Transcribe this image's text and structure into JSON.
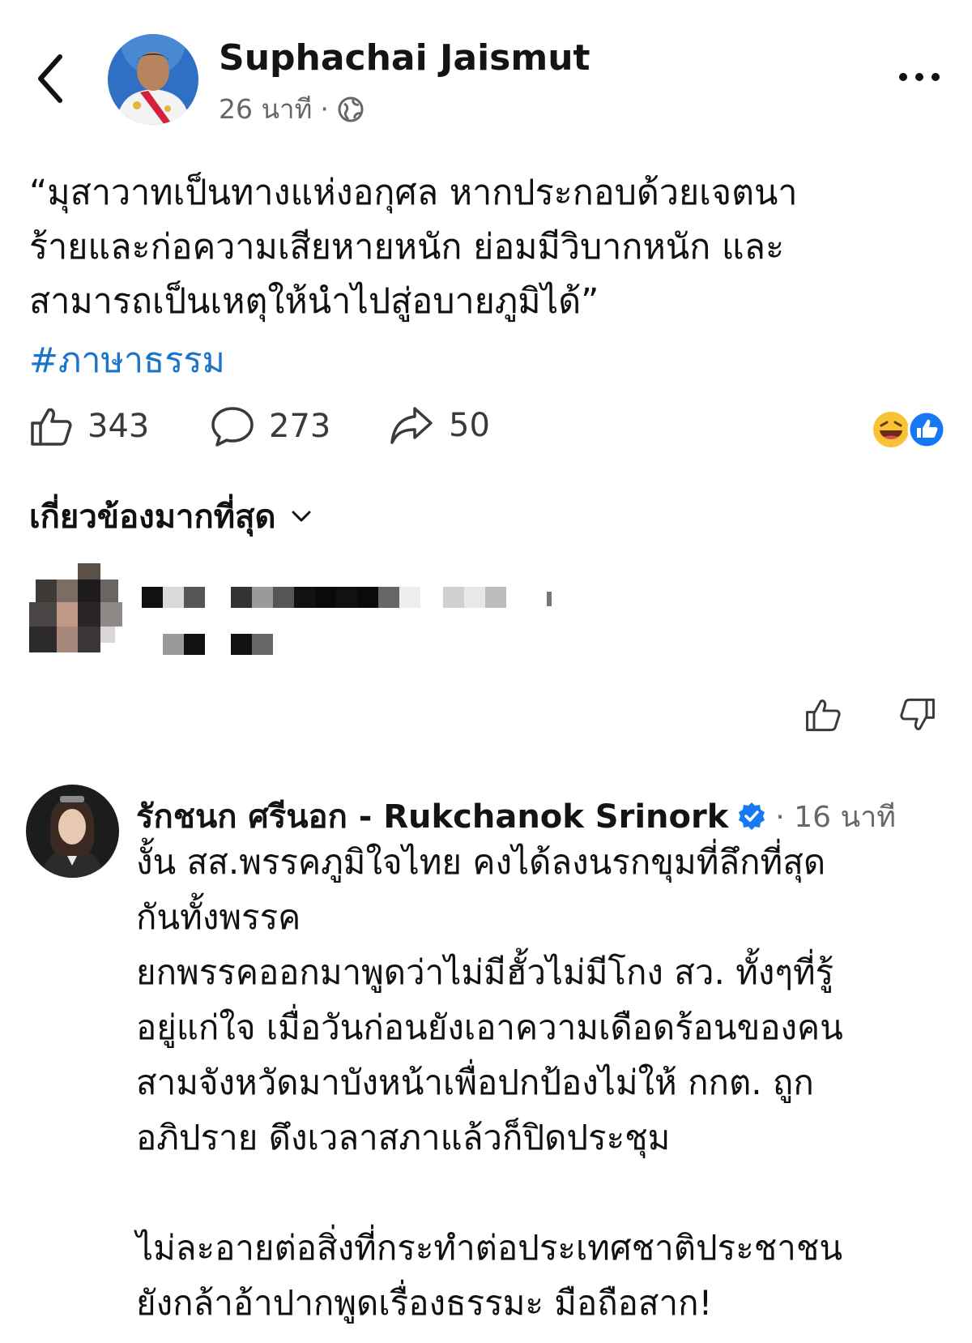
{
  "header": {
    "author_name": "Suphachai Jaismut",
    "time": "26 นาที",
    "separator": "·",
    "back_icon": "chevron-left-icon",
    "more_icon": "ellipsis-icon",
    "privacy_icon": "globe-icon"
  },
  "post": {
    "lines": [
      "“มุสาวาทเป็นทางแห่งอกุศล หากประกอบด้วยเจตนา",
      "ร้ายและก่อความเสียหายหนัก ย่อมมีวิบากหนัก และ",
      "สามารถเป็นเหตุให้นำไปสู่อบายภูมิได้”"
    ],
    "hashtag": "#ภาษาธรรม"
  },
  "stats": {
    "likes": "343",
    "comments": "273",
    "shares": "50",
    "reaction_icons": [
      "laughing-face-icon",
      "like-thumb-icon"
    ]
  },
  "comments_sort": {
    "label": "เกี่ยวข้องมากที่สุด"
  },
  "comment": {
    "name": "รักชนก ศรีนอก - Rukchanok Srinork",
    "separator": "·",
    "time": "16 นาที",
    "verified_icon": "verified-badge-icon",
    "lines": [
      "งั้น สส.พรรคภูมิใจไทย คงได้ลงนรกขุมที่ลึกที่สุด",
      "กันทั้งพรรค",
      "ยกพรรคออกมาพูดว่าไม่มีฮั้วไม่มีโกง สว. ทั้งๆที่รู้",
      "อยู่แก่ใจ เมื่อวันก่อนยังเอาความเดือดร้อนของคน",
      "สามจังหวัดมาบังหน้าเพื่อปกป้องไม่ให้ กกต. ถูก",
      "อภิปราย ดึงเวลาสภาแล้วก็ปิดประชุม",
      "",
      "ไม่ละอายต่อสิ่งที่กระทำต่อประเทศชาติประชาชน",
      "ยังกล้าอ้าปากพูดเรื่องธรรมะ มือถือสาก!"
    ]
  },
  "colors": {
    "link": "#1a74c9",
    "secondary_text": "#65676b",
    "facebook_blue": "#1877f2"
  }
}
